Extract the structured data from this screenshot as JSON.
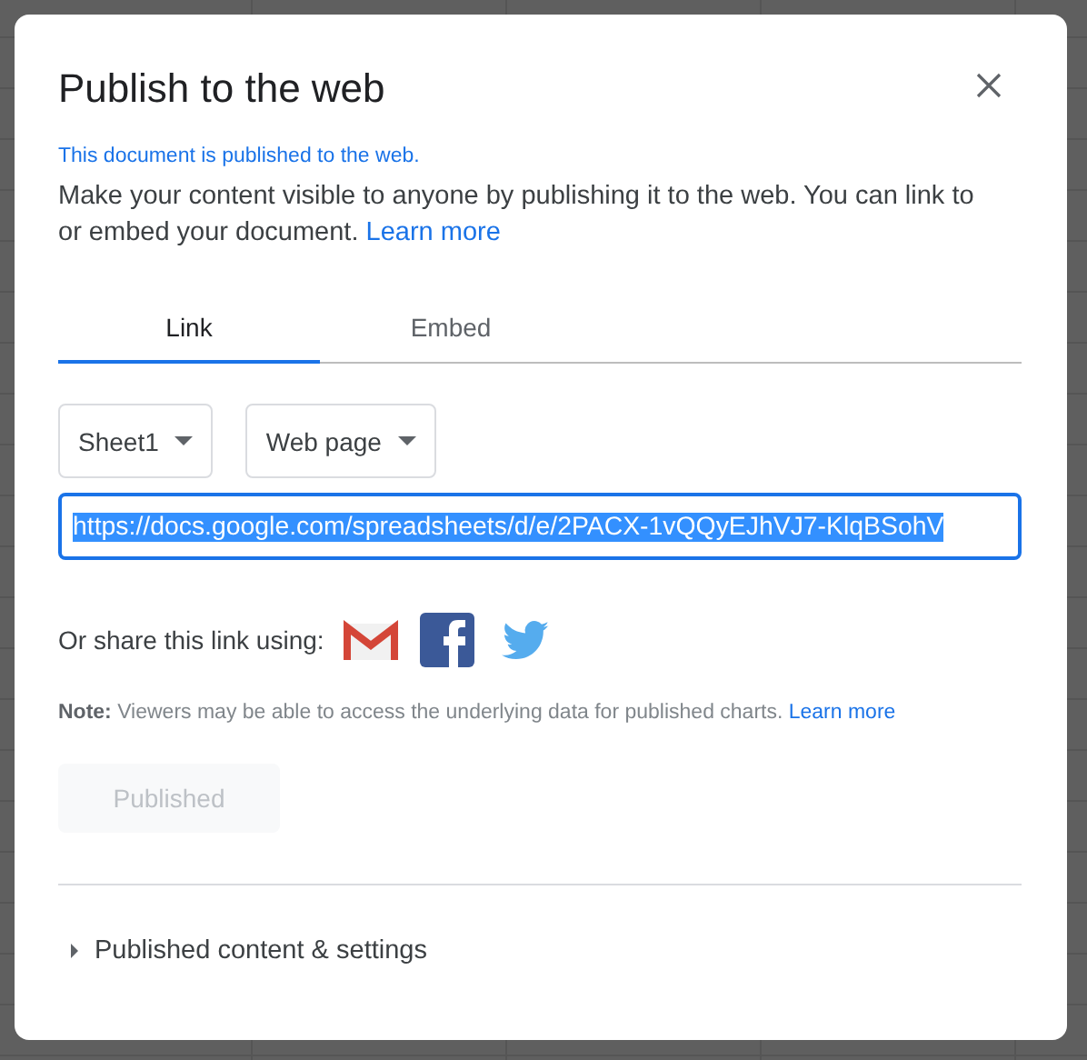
{
  "dialog": {
    "title": "Publish to the web",
    "status": "This document is published to the web.",
    "description": "Make your content visible to anyone by publishing it to the web. You can link to or embed your document.",
    "description_link": "Learn more",
    "tabs": [
      {
        "label": "Link",
        "selected": true
      },
      {
        "label": "Embed",
        "selected": false
      }
    ],
    "selects": [
      {
        "value": "Sheet1"
      },
      {
        "value": "Web page"
      }
    ],
    "url_field": {
      "value": "https://docs.google.com/spreadsheets/d/e/2PACX-1vQQyEJhVJ7-KlqBSohV",
      "selected": true
    },
    "share_label": "Or share this link using:",
    "note": {
      "text": "**Note:** Viewers may be able to access the underlying data for published charts.",
      "link": "Learn more"
    },
    "publish_button": {
      "label": "Published",
      "disabled": true
    },
    "settings_section": {
      "label": "Published content & settings",
      "expanded": false
    }
  }
}
